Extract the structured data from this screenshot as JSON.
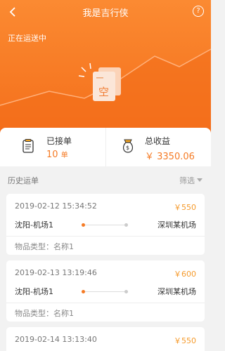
{
  "header": {
    "title": "我是吉行侠",
    "help_label": "?"
  },
  "status_text": "正在运送中",
  "empty_illustration_text": "空",
  "stats": {
    "accepted": {
      "label": "已接单",
      "value": "10",
      "unit": "单"
    },
    "income": {
      "label": "总收益",
      "value": "￥ 3350.06"
    }
  },
  "history": {
    "title": "历史运单",
    "filter_label": "筛选",
    "orders": [
      {
        "time": "2019-02-12 15:34:52",
        "price": "￥550",
        "from": "沈阳-机场1",
        "to": "深圳某机场",
        "item_type": "物品类型：名称1"
      },
      {
        "time": "2019-02-13 13:19:46",
        "price": "￥600",
        "from": "沈阳-机场1",
        "to": "深圳某机场",
        "item_type": "物品类型：名称1"
      },
      {
        "time": "2019-02-14 13:13:40",
        "price": "￥550",
        "from": "",
        "to": "",
        "item_type": ""
      }
    ]
  },
  "colors": {
    "accent": "#f57b25",
    "price": "#f59a2b"
  }
}
